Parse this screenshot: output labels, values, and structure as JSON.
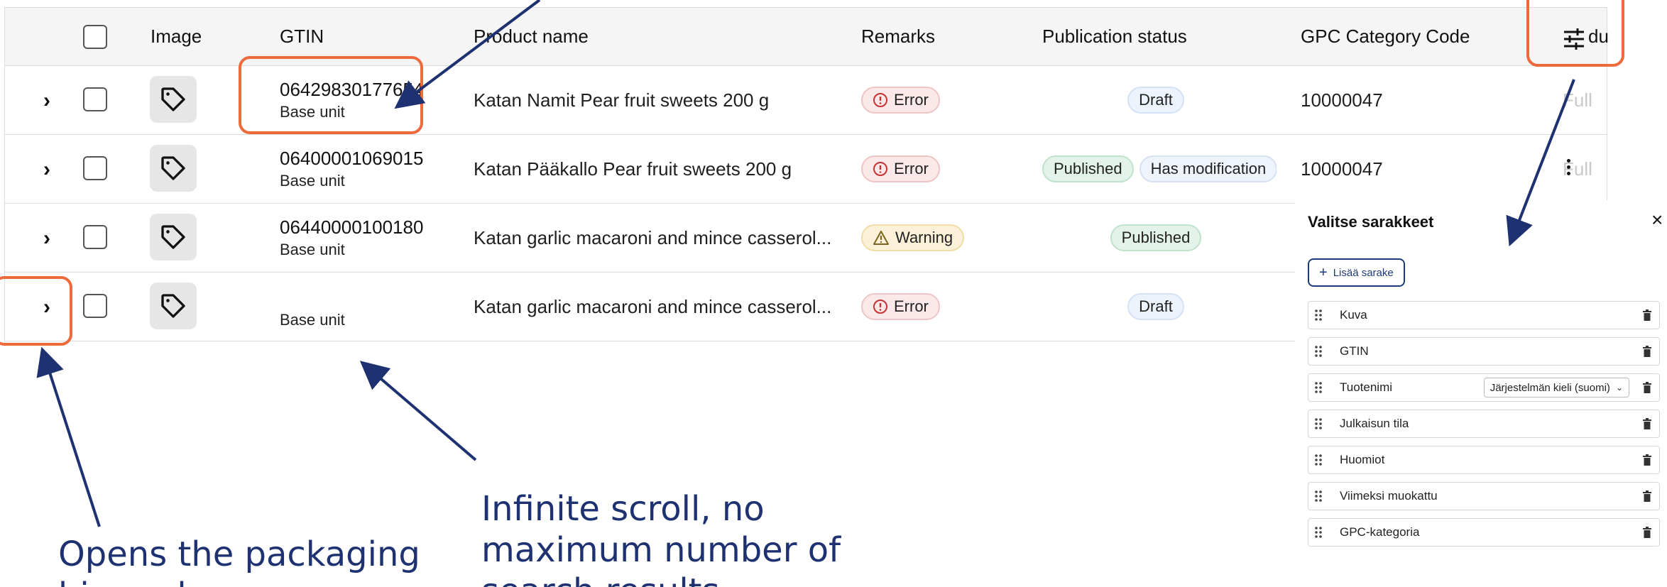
{
  "table": {
    "headers": {
      "image": "Image",
      "gtin": "GTIN",
      "product_name": "Product name",
      "remarks": "Remarks",
      "publication_status": "Publication status",
      "gpc_category_code": "GPC Category Code",
      "cut_off": "du"
    },
    "rows": [
      {
        "gtin": "06429830177654",
        "unit": "Base unit",
        "product_name": "Katan Namit Pear fruit sweets 200 g",
        "remark": "Error",
        "status": [
          "Draft"
        ],
        "gpc": "10000047",
        "cut_off": "Full"
      },
      {
        "gtin": "06400001069015",
        "unit": "Base unit",
        "product_name": "Katan Pääkallo Pear fruit sweets 200 g",
        "remark": "Error",
        "status": [
          "Published",
          "Has modification"
        ],
        "gpc": "10000047",
        "cut_off": "Full"
      },
      {
        "gtin": "06440000100180",
        "unit": "Base unit",
        "product_name": "Katan garlic macaroni and mince casserol...",
        "remark": "Warning",
        "status": [
          "Published"
        ],
        "gpc": "",
        "cut_off": ""
      },
      {
        "gtin": "",
        "unit": "Base unit",
        "product_name": "Katan garlic macaroni and mince casserol...",
        "remark": "Error",
        "status": [
          "Draft"
        ],
        "gpc": "",
        "cut_off": ""
      }
    ]
  },
  "column_panel": {
    "title": "Valitse sarakkeet",
    "add_button": "Lisää sarake",
    "columns": [
      {
        "label": "Kuva"
      },
      {
        "label": "GTIN"
      },
      {
        "label": "Tuotenimi",
        "select": "Järjestelmän kieli (suomi)"
      },
      {
        "label": "Julkaisun tila"
      },
      {
        "label": "Huomiot"
      },
      {
        "label": "Viimeksi muokattu"
      },
      {
        "label": "GPC-kategoria"
      }
    ]
  },
  "annotations": {
    "packaging": "Opens the packaging hierarchy",
    "scroll": "Infinite scroll, no maximum number of search results"
  },
  "colors": {
    "highlight": "#ec6a3c",
    "annotation": "#1e3272",
    "header_bg": "#f5f5f5",
    "error_badge": "#fbe9e9",
    "warning_badge": "#fbf1d9",
    "published_badge": "#e4f3e9",
    "draft_badge": "#edf3fc"
  },
  "icons": [
    "chevron-right-icon",
    "tag-icon",
    "error-circle-icon",
    "warning-triangle-icon",
    "sliders-icon",
    "close-icon",
    "grip-icon",
    "trash-icon",
    "plus-icon",
    "chevron-down-icon"
  ]
}
